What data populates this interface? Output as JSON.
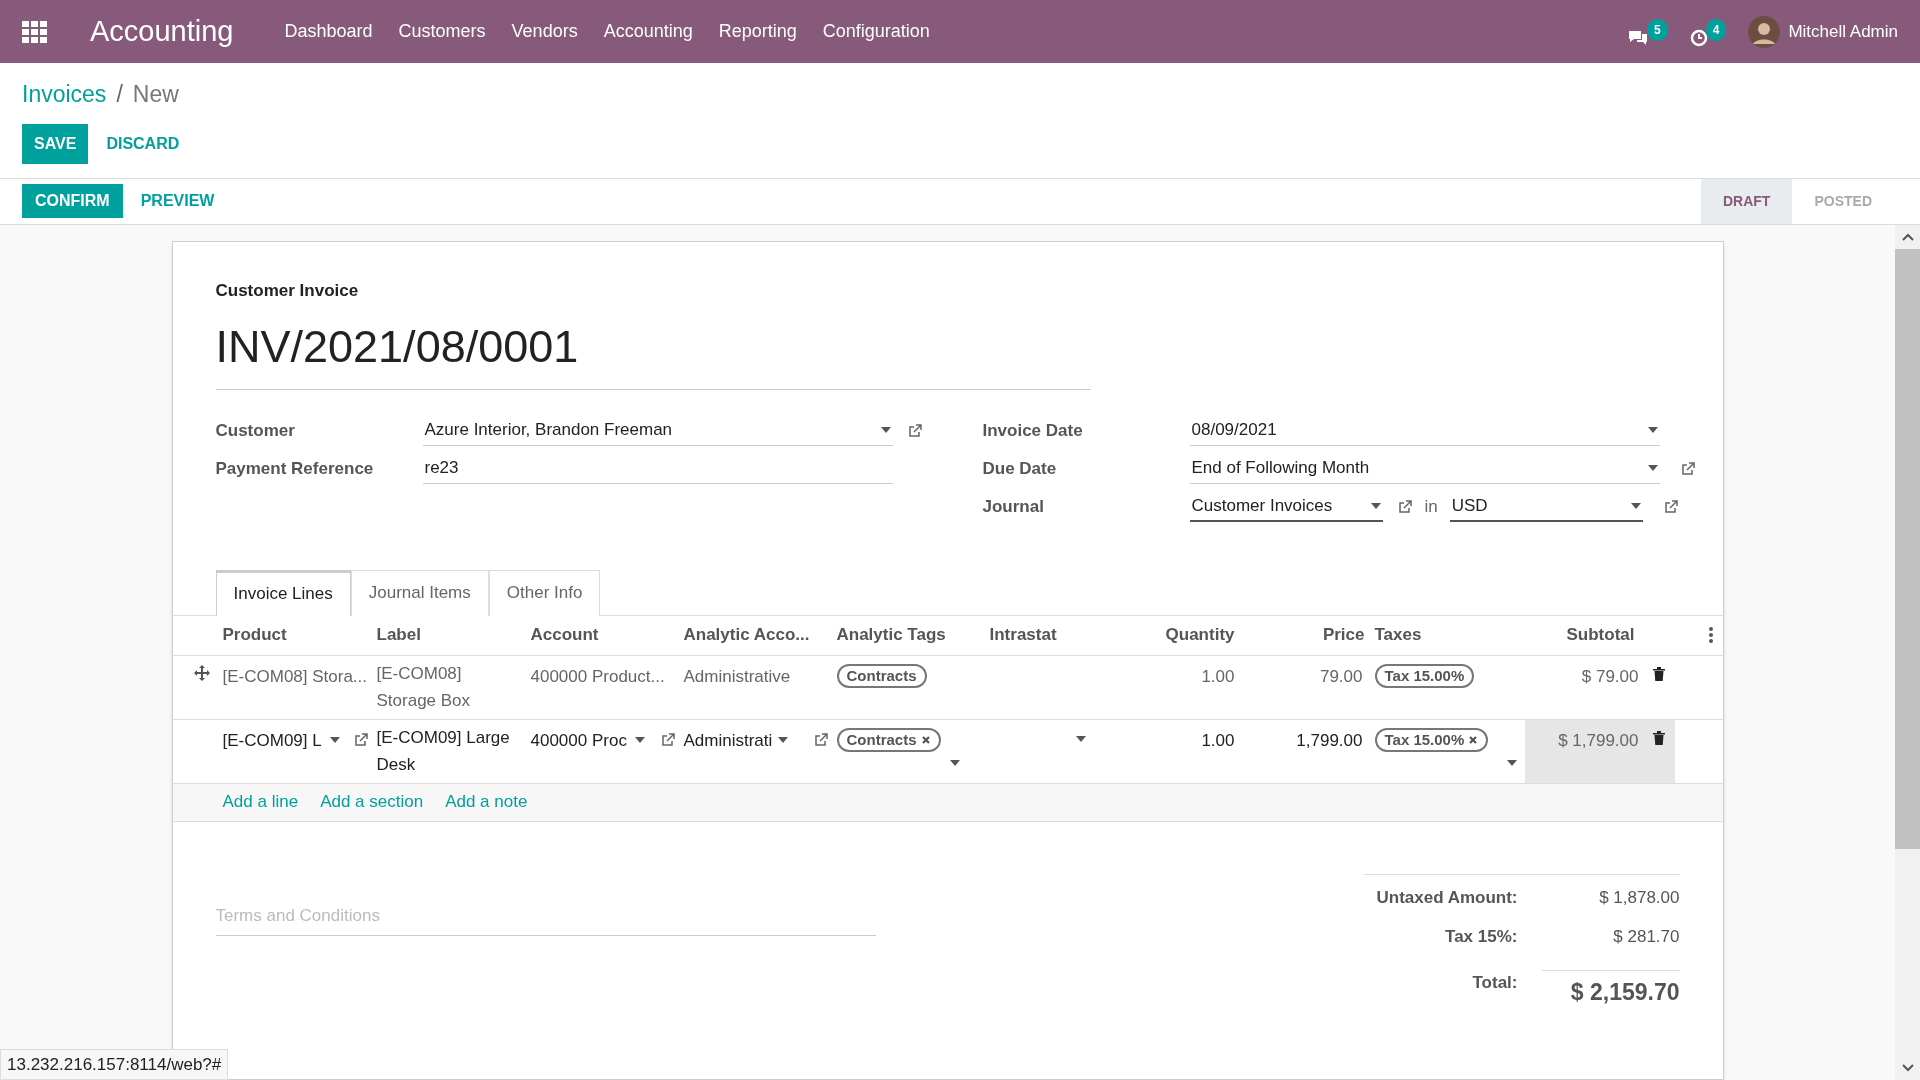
{
  "navbar": {
    "app_title": "Accounting",
    "menu": [
      "Dashboard",
      "Customers",
      "Vendors",
      "Accounting",
      "Reporting",
      "Configuration"
    ],
    "messages_count": "5",
    "activities_count": "4",
    "user": "Mitchell Admin"
  },
  "breadcrumb": {
    "parent": "Invoices",
    "separator": "/",
    "current": "New"
  },
  "buttons": {
    "save": "SAVE",
    "discard": "DISCARD",
    "confirm": "CONFIRM",
    "preview": "PREVIEW"
  },
  "stages": [
    {
      "label": "DRAFT",
      "selected": true
    },
    {
      "label": "POSTED",
      "selected": false
    }
  ],
  "form": {
    "type_label": "Customer Invoice",
    "number": "INV/2021/08/0001",
    "left_fields": [
      {
        "label": "Customer",
        "value": "Azure Interior, Brandon Freeman",
        "kind": "many2one"
      },
      {
        "label": "Payment Reference",
        "value": "re23",
        "kind": "char"
      }
    ],
    "right_fields": [
      {
        "label": "Invoice Date",
        "value": "08/09/2021",
        "kind": "date"
      },
      {
        "label": "Due Date",
        "value": "End of Following Month",
        "kind": "many2one"
      }
    ],
    "journal": {
      "label": "Journal",
      "value": "Customer Invoices",
      "in": "in",
      "currency": "USD"
    }
  },
  "tabs": [
    {
      "label": "Invoice Lines",
      "selected": true
    },
    {
      "label": "Journal Items",
      "selected": false
    },
    {
      "label": "Other Info",
      "selected": false
    }
  ],
  "table": {
    "columns": [
      "Product",
      "Label",
      "Account",
      "Analytic Acco...",
      "Analytic Tags",
      "Intrastat",
      "Quantity",
      "Price",
      "Taxes",
      "Subtotal"
    ],
    "rows": [
      {
        "editing": false,
        "product": "[E-COM08] Stora...",
        "label": "[E-COM08] Storage Box",
        "account": "400000 Product...",
        "analytic": "Administrative",
        "tag": "Contracts",
        "quantity": "1.00",
        "price": "79.00",
        "tax": "Tax 15.00%",
        "subtotal": "$ 79.00"
      },
      {
        "editing": true,
        "product": "[E-COM09] L",
        "label": "[E-COM09] Large Desk",
        "account": "400000 Proc",
        "analytic": "Administrati",
        "tag": "Contracts",
        "quantity": "1.00",
        "price": "1,799.00",
        "tax": "Tax 15.00%",
        "subtotal": "$ 1,799.00"
      }
    ],
    "add_links": [
      "Add a line",
      "Add a section",
      "Add a note"
    ]
  },
  "terms": {
    "placeholder": "Terms and Conditions"
  },
  "totals": [
    {
      "label": "Untaxed Amount:",
      "value": "$ 1,878.00",
      "kind": "plain"
    },
    {
      "label": "Tax 15%:",
      "value": "$ 281.70",
      "kind": "plain"
    },
    {
      "label": "Total:",
      "value": "$ 2,159.70",
      "kind": "grand"
    }
  ],
  "status_url": "13.232.216.157:8114/web?#"
}
